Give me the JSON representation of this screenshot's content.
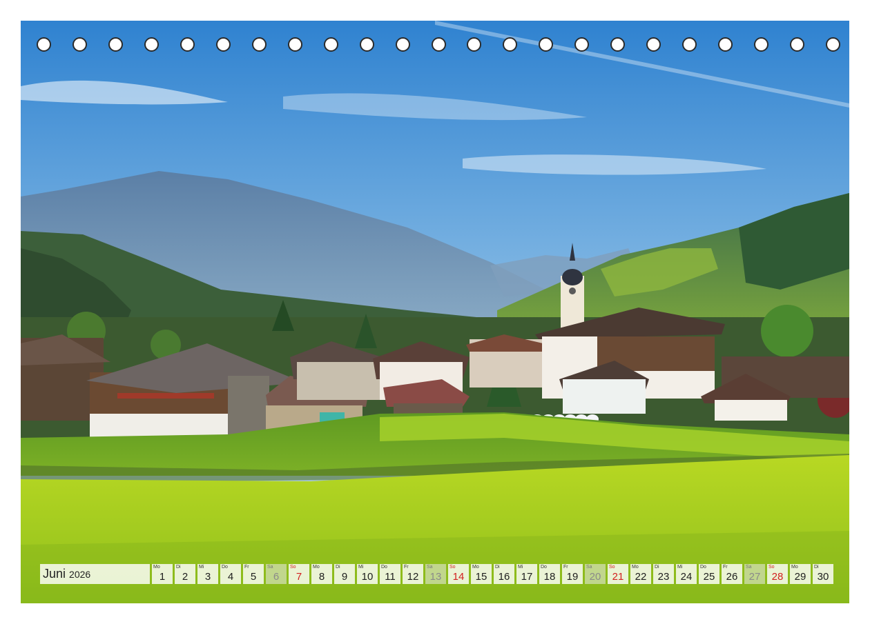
{
  "calendar": {
    "month": "Juni",
    "year": "2026",
    "days": [
      {
        "wd": "Mo",
        "d": "1",
        "type": "weekday"
      },
      {
        "wd": "Di",
        "d": "2",
        "type": "weekday"
      },
      {
        "wd": "Mi",
        "d": "3",
        "type": "weekday"
      },
      {
        "wd": "Do",
        "d": "4",
        "type": "weekday"
      },
      {
        "wd": "Fr",
        "d": "5",
        "type": "weekday"
      },
      {
        "wd": "Sa",
        "d": "6",
        "type": "sat"
      },
      {
        "wd": "So",
        "d": "7",
        "type": "sun"
      },
      {
        "wd": "Mo",
        "d": "8",
        "type": "weekday"
      },
      {
        "wd": "Di",
        "d": "9",
        "type": "weekday"
      },
      {
        "wd": "Mi",
        "d": "10",
        "type": "weekday"
      },
      {
        "wd": "Do",
        "d": "11",
        "type": "weekday"
      },
      {
        "wd": "Fr",
        "d": "12",
        "type": "weekday"
      },
      {
        "wd": "Sa",
        "d": "13",
        "type": "sat"
      },
      {
        "wd": "So",
        "d": "14",
        "type": "sun"
      },
      {
        "wd": "Mo",
        "d": "15",
        "type": "weekday"
      },
      {
        "wd": "Di",
        "d": "16",
        "type": "weekday"
      },
      {
        "wd": "Mi",
        "d": "17",
        "type": "weekday"
      },
      {
        "wd": "Do",
        "d": "18",
        "type": "weekday"
      },
      {
        "wd": "Fr",
        "d": "19",
        "type": "weekday"
      },
      {
        "wd": "Sa",
        "d": "20",
        "type": "sat"
      },
      {
        "wd": "So",
        "d": "21",
        "type": "sun"
      },
      {
        "wd": "Mo",
        "d": "22",
        "type": "weekday"
      },
      {
        "wd": "Di",
        "d": "23",
        "type": "weekday"
      },
      {
        "wd": "Mi",
        "d": "24",
        "type": "weekday"
      },
      {
        "wd": "Do",
        "d": "25",
        "type": "weekday"
      },
      {
        "wd": "Fr",
        "d": "26",
        "type": "weekday"
      },
      {
        "wd": "Sa",
        "d": "27",
        "type": "sat"
      },
      {
        "wd": "So",
        "d": "28",
        "type": "sun"
      },
      {
        "wd": "Mo",
        "d": "29",
        "type": "weekday"
      },
      {
        "wd": "Di",
        "d": "30",
        "type": "weekday"
      }
    ]
  },
  "binding": {
    "hole_count": 23
  },
  "colors": {
    "sunday": "#d21f1f",
    "saturday": "#8a8a8a",
    "sky": "#3d8fd6",
    "meadow": "#a8d21e"
  }
}
